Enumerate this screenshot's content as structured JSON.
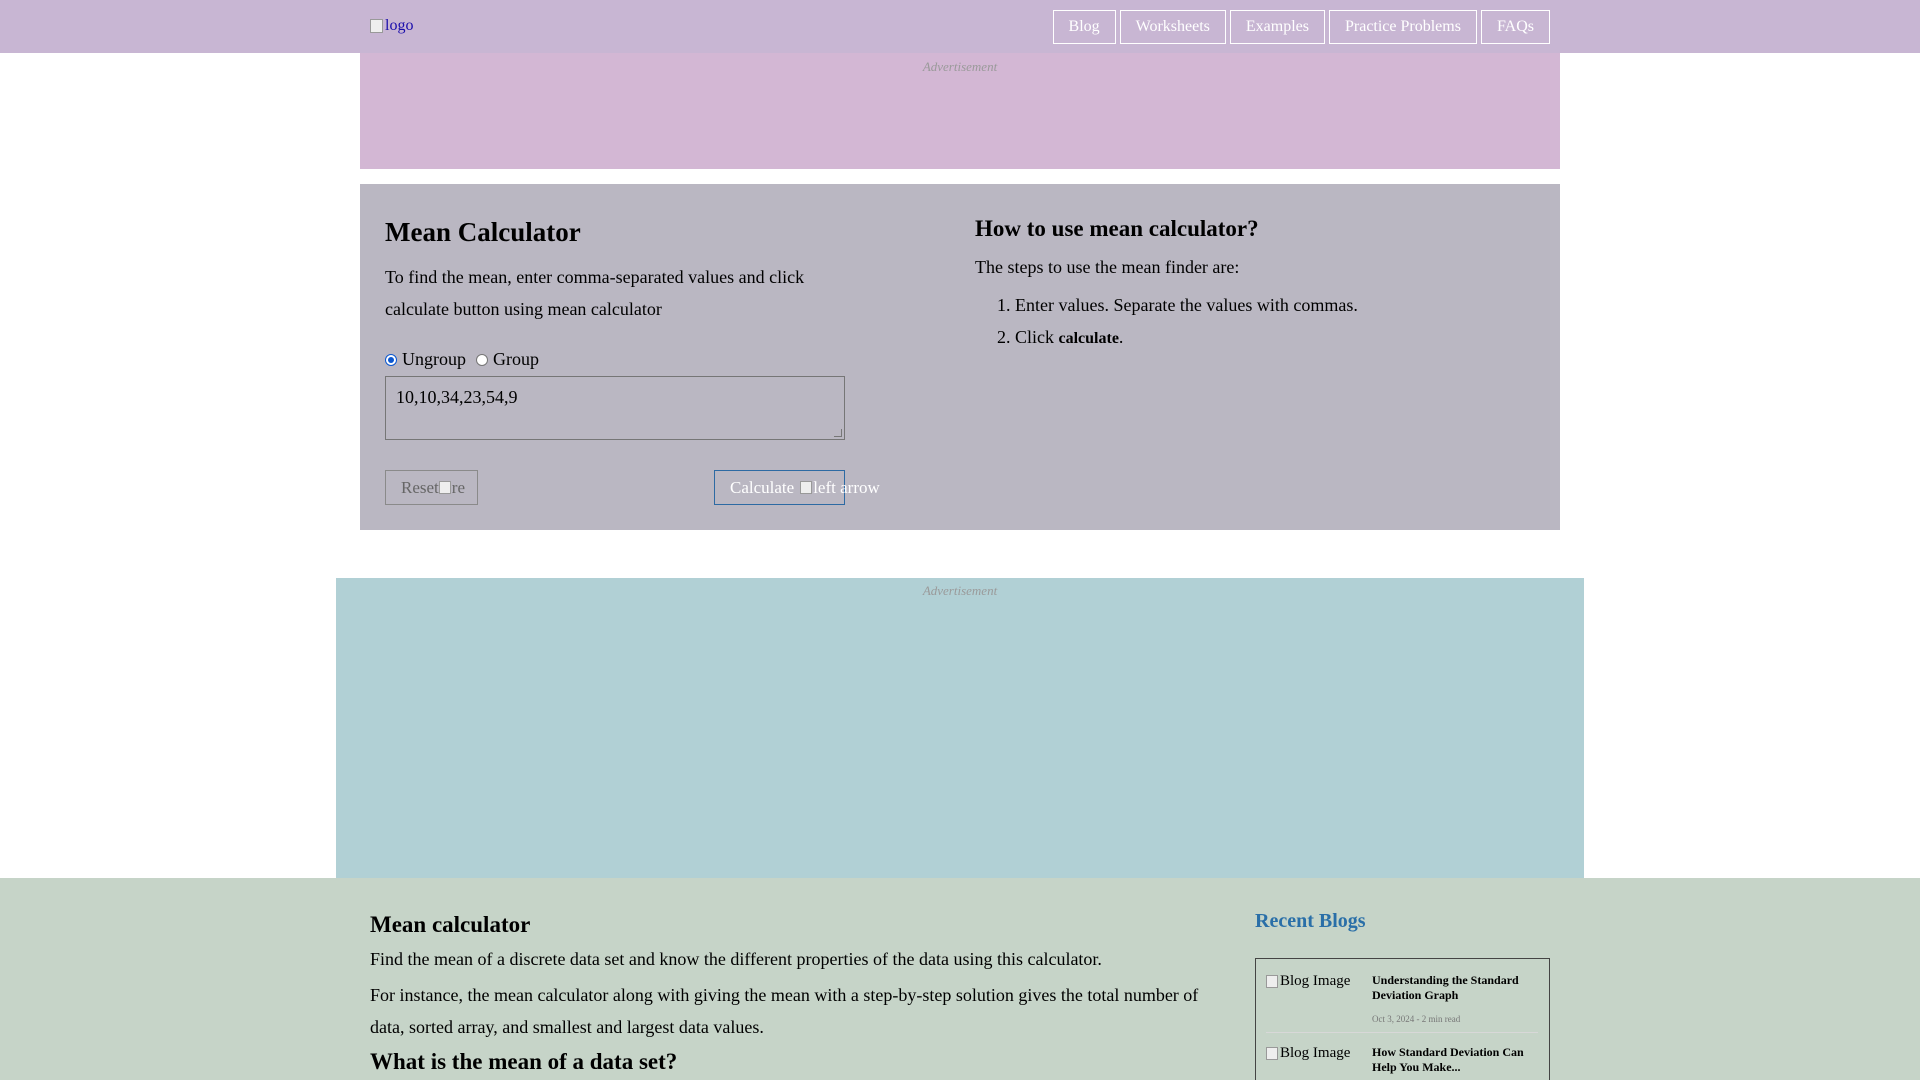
{
  "header": {
    "logo_alt": "logo",
    "nav": [
      "Blog",
      "Worksheets",
      "Examples",
      "Practice Problems",
      "FAQs"
    ]
  },
  "ads": {
    "label": "Advertisement"
  },
  "calculator": {
    "title": "Mean Calculator",
    "description": "To find the mean, enter comma-separated values and click calculate button using mean calculator",
    "radio_ungroup": "Ungroup",
    "radio_group": "Group",
    "selected_mode": "Ungroup",
    "values": "10,10,34,23,54,9",
    "reset_label": "Reset",
    "reset_icon_alt": "re",
    "calculate_label": "Calculate",
    "calculate_icon_alt": "left arrow"
  },
  "howto": {
    "title": "How to use mean calculator?",
    "intro": "The steps to use the mean finder are:",
    "step1": "Enter values. Separate the values with commas.",
    "step2_prefix": "Click ",
    "step2_bold": "calculate",
    "step2_suffix": "."
  },
  "article": {
    "title": "Mean calculator",
    "para1": "Find the mean of a discrete data set and know the different properties of the data using this calculator.",
    "para2": "For instance, the mean calculator along with giving the mean with a step-by-step solution gives the total number of data, sorted array, and smallest and largest data values.",
    "subtitle": "What is the mean of a data set?"
  },
  "recent_blogs": {
    "heading": "Recent Blogs",
    "image_alt": "Blog Image",
    "items": [
      {
        "title": "Understanding the Standard Deviation Graph",
        "meta": "Oct 3, 2024 - 2 min read"
      },
      {
        "title": "How Standard Deviation Can Help You Make...",
        "meta": ""
      }
    ]
  },
  "colors": {
    "nav_bg": "#c8b6d3",
    "ad1_bg": "#d3b7d4",
    "calc_bg": "#bab7c2",
    "ad2_bg": "#b1d0d5",
    "content_bg": "#c6d4c8",
    "accent": "#2a6fa8"
  }
}
